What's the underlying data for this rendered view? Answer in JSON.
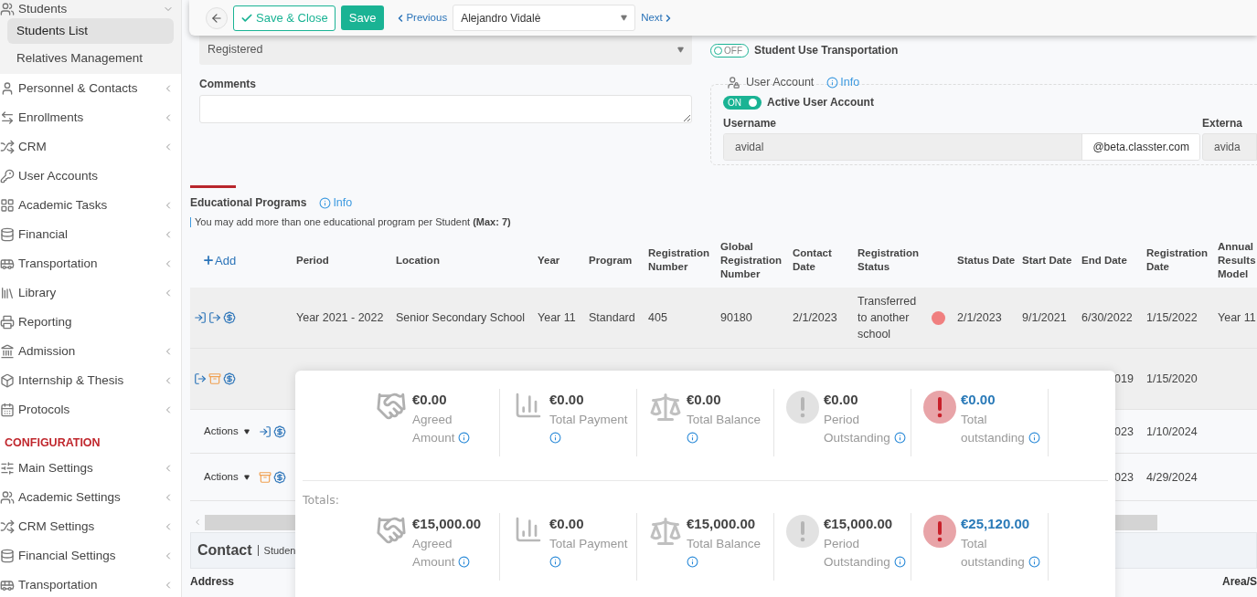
{
  "sidebar": {
    "items": [
      {
        "label": "Students",
        "expandable": true,
        "expanded": true,
        "children": [
          {
            "label": "Students List",
            "selected": true
          },
          {
            "label": "Relatives Management",
            "selected": false
          }
        ]
      },
      {
        "label": "Personnel & Contacts",
        "expandable": true,
        "expanded": false
      },
      {
        "label": "Enrollments",
        "expandable": true,
        "expanded": false
      },
      {
        "label": "CRM",
        "expandable": true,
        "expanded": false
      },
      {
        "label": "User Accounts",
        "expandable": false,
        "expanded": false
      },
      {
        "label": "Academic Tasks",
        "expandable": true,
        "expanded": false
      },
      {
        "label": "Financial",
        "expandable": true,
        "expanded": false
      },
      {
        "label": "Transportation",
        "expandable": true,
        "expanded": false
      },
      {
        "label": "Library",
        "expandable": true,
        "expanded": false
      },
      {
        "label": "Reporting",
        "expandable": false,
        "expanded": false
      },
      {
        "label": "Admission",
        "expandable": true,
        "expanded": false
      },
      {
        "label": "Internship & Thesis",
        "expandable": true,
        "expanded": false
      },
      {
        "label": "Protocols",
        "expandable": true,
        "expanded": false
      }
    ],
    "section_title": "CONFIGURATION",
    "config_items": [
      {
        "label": "Main Settings",
        "expandable": true,
        "expanded": false
      },
      {
        "label": "Academic Settings",
        "expandable": true,
        "expanded": false
      },
      {
        "label": "CRM Settings",
        "expandable": true,
        "expanded": false
      },
      {
        "label": "Financial Settings",
        "expandable": true,
        "expanded": false
      },
      {
        "label": "Transportation",
        "expandable": true,
        "expanded": false
      }
    ]
  },
  "toolbar": {
    "save_close": "Save & Close",
    "save": "Save",
    "previous": "Previous",
    "student": "Alejandro Vidalė",
    "next": "Next"
  },
  "form": {
    "status_select": "Registered",
    "comments_label": "Comments",
    "transport_toggle": {
      "on": false,
      "state_label": "OFF",
      "label": "Student Use Transportation"
    },
    "user_account": {
      "title": "User Account",
      "info": "Info",
      "active_toggle": {
        "on": true,
        "state_label": "ON",
        "label": "Active User Account"
      },
      "username_label": "Username",
      "username": "avidal",
      "domain": "@beta.classter.com",
      "external_label": "Externa",
      "external_value": "avida"
    }
  },
  "programs": {
    "title": "Educational Programs",
    "info": "Info",
    "note": "You may add more than one educational program per Student **(Max: 7)**",
    "add": "Add",
    "columns": [
      "Period",
      "Location",
      "Year",
      "Program",
      "Registration Number",
      "Global Registration Number",
      "Contact Date",
      "Registration Status",
      "Status Date",
      "Start Date",
      "End Date",
      "Registration Date",
      "Annual Results Model"
    ],
    "rows": [
      {
        "selected": true,
        "action_icons": [
          {
            "kind": "enter"
          },
          {
            "kind": "exit"
          },
          {
            "kind": "bill"
          }
        ],
        "color": "#f07f7f",
        "cells": [
          "Year 2021 - 2022",
          "Senior Secondary School",
          "Year 11",
          "Standard",
          "405",
          "90180",
          "2/1/2023",
          "Transferred to another school",
          "2/1/2023",
          "9/1/2021",
          "6/30/2022",
          "1/15/2022",
          "Year 11"
        ]
      },
      {
        "selected": true,
        "action_icons": [
          {
            "kind": "exit"
          },
          {
            "kind": "archive"
          },
          {
            "kind": "bill"
          }
        ],
        "cells": [
          null,
          null,
          null,
          null,
          null,
          null,
          null,
          null,
          null,
          null,
          "019",
          "1/15/2020",
          null
        ]
      },
      {
        "selected": false,
        "actions": "Actions",
        "action_icons": [
          {
            "kind": "enter"
          },
          {
            "kind": "bill"
          }
        ],
        "cells": [
          null,
          null,
          null,
          null,
          null,
          null,
          null,
          null,
          null,
          null,
          "023",
          "1/10/2024",
          null
        ]
      },
      {
        "selected": false,
        "actions": "Actions",
        "action_icons": [
          {
            "kind": "archive"
          },
          {
            "kind": "bill"
          }
        ],
        "cells": [
          null,
          null,
          null,
          null,
          null,
          null,
          null,
          null,
          null,
          null,
          "023",
          "4/29/2024",
          null
        ]
      }
    ]
  },
  "contact": {
    "title": "Contact",
    "subtitle": "Studen",
    "address_label": "Address",
    "area_label": "Area/S"
  },
  "summary": {
    "groups": [
      {
        "stats": [
          {
            "kind": "agreed",
            "value": "€0.00",
            "label": "Agreed Amount"
          },
          {
            "kind": "payment",
            "value": "€0.00",
            "label": "Total Payment"
          },
          {
            "kind": "balance",
            "value": "€0.00",
            "label": "Total Balance"
          },
          {
            "kind": "period",
            "value": "€0.00",
            "label": "Period Outstanding"
          },
          {
            "kind": "total",
            "value": "€0.00",
            "label": "Total outstanding"
          }
        ]
      },
      {
        "label": "Totals:",
        "stats": [
          {
            "kind": "agreed",
            "value": "€15,000.00",
            "label": "Agreed Amount"
          },
          {
            "kind": "payment",
            "value": "€0.00",
            "label": "Total Payment"
          },
          {
            "kind": "balance",
            "value": "€15,000.00",
            "label": "Total Balance"
          },
          {
            "kind": "period",
            "value": "€15,000.00",
            "label": "Period Outstanding"
          },
          {
            "kind": "total",
            "value": "€25,120.00",
            "label": "Total outstanding"
          }
        ]
      }
    ]
  }
}
